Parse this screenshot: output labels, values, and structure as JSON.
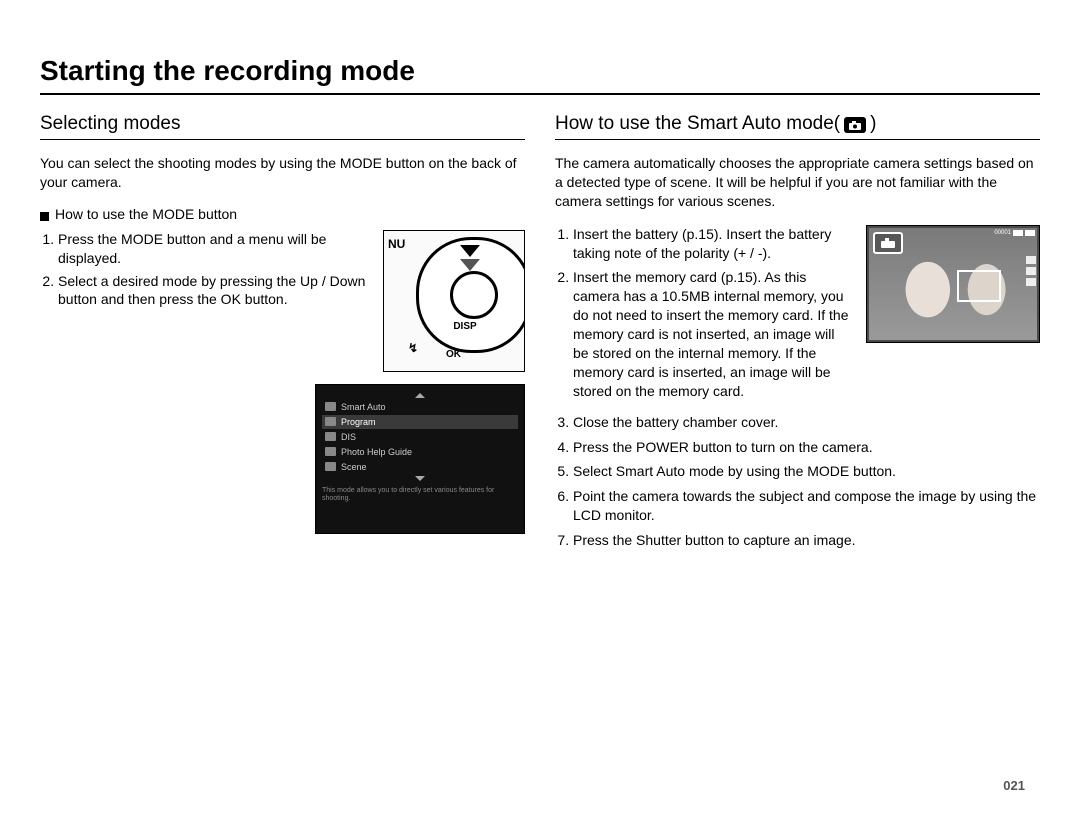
{
  "title": "Starting the recording mode",
  "page_number": "021",
  "left": {
    "subhead": "Selecting modes",
    "intro": "You can select the shooting modes by using the MODE button on the back of your camera.",
    "howto_heading": "How to use the MODE button",
    "steps": [
      "Press the MODE button and a menu will be displayed.",
      "Select a desired mode by pressing the Up / Down button and then press the OK button."
    ],
    "camera": {
      "nu": "NU",
      "disp": "DISP",
      "ok": "OK",
      "flash": "↯"
    },
    "menu": {
      "items": [
        "Smart Auto",
        "Program",
        "DIS",
        "Photo Help Guide",
        "Scene"
      ],
      "selected_index": 1,
      "hint": "This mode allows you to directly set various features for shooting."
    }
  },
  "right": {
    "subhead_pre": "How to use the Smart Auto mode(",
    "subhead_post": " )",
    "icon_label": "SMART",
    "intro": "The camera automatically chooses the appropriate camera settings based on a detected type of scene. It will be helpful if you are not familiar with the camera settings for various scenes.",
    "steps": [
      "Insert the battery (p.15). Insert the battery taking note of the polarity (+ / -).",
      "Insert the memory card (p.15). As this camera has a 10.5MB internal memory, you do not need to insert the memory card. If the memory card is not inserted, an image will be stored on the internal memory. If the memory card is inserted, an image will be stored on the memory card.",
      "Close the battery chamber cover.",
      "Press the POWER button to turn on the camera.",
      "Select Smart Auto mode by using the MODE button.",
      "Point the camera towards the subject and compose the image by using the LCD monitor.",
      "Press the Shutter button to capture an image."
    ],
    "lcd_top_counter": "00001"
  }
}
